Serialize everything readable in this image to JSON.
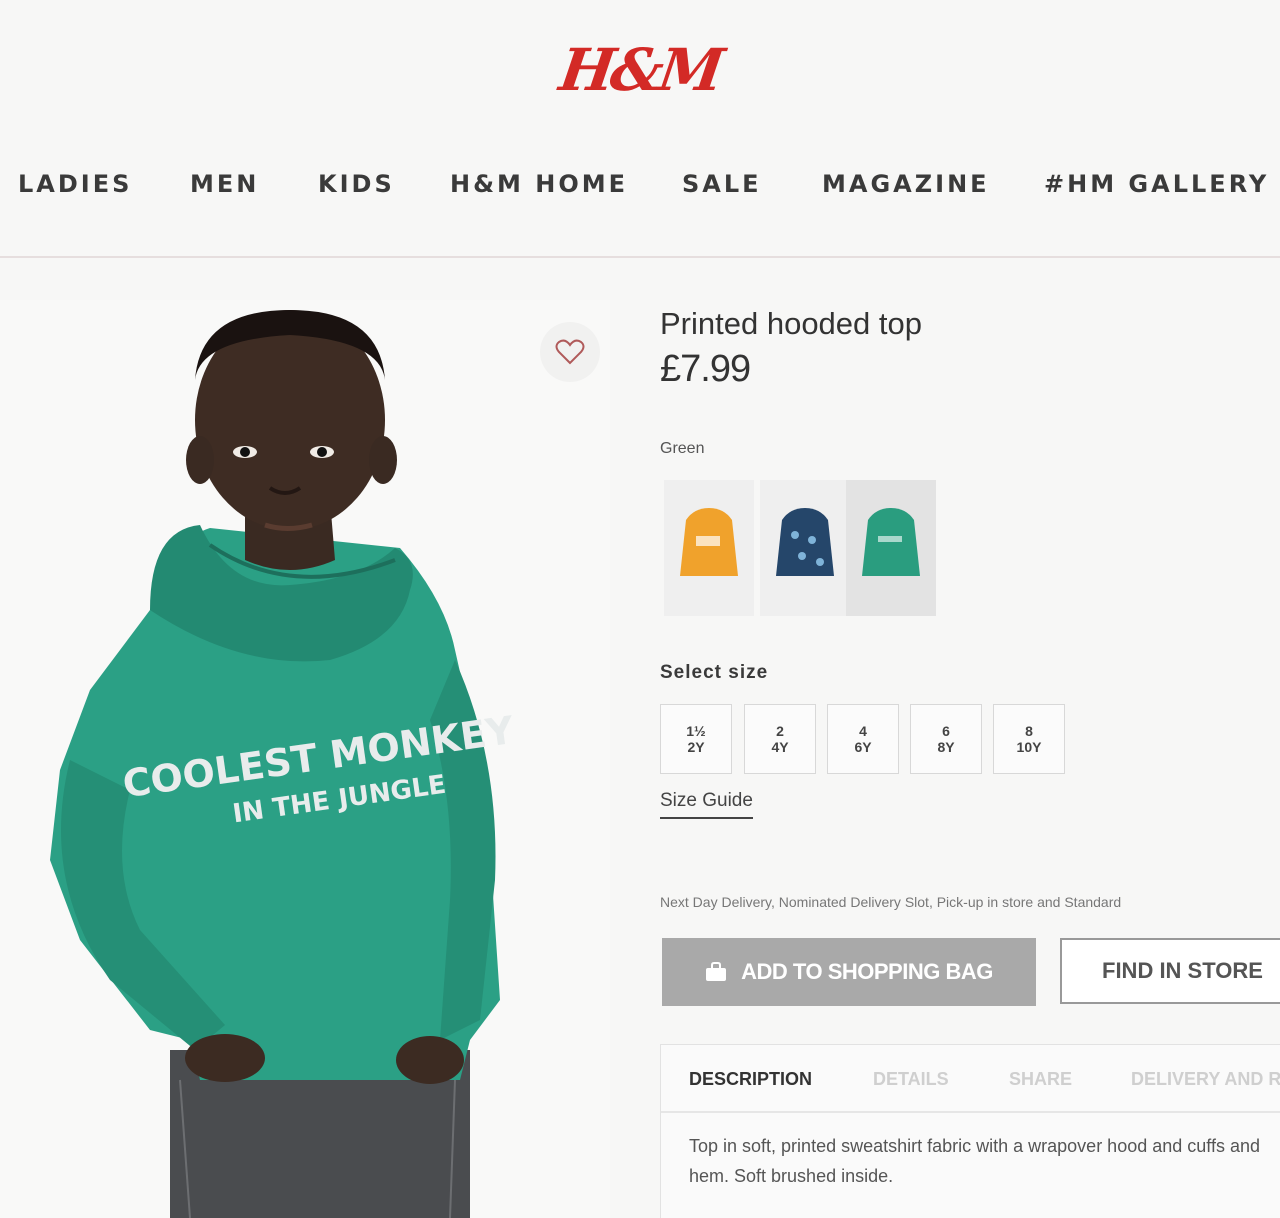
{
  "brand": {
    "logo_text": "H&M",
    "logo_color": "#d32a26"
  },
  "nav": {
    "items": [
      "LADIES",
      "MEN",
      "KIDS",
      "H&M HOME",
      "SALE",
      "MAGAZINE",
      "#HM GALLERY"
    ]
  },
  "product": {
    "title": "Printed hooded top",
    "price": "£7.99",
    "selected_color": "Green",
    "hoodie_print_line1": "COOLEST MONKEY",
    "hoodie_print_line2": "IN THE JUNGLE",
    "swatches": [
      {
        "color": "#f0a22c",
        "name": "orange"
      },
      {
        "color": "#25466a",
        "name": "navy-print"
      },
      {
        "color": "#2a9d7f",
        "name": "green",
        "selected": true
      }
    ]
  },
  "sizes": {
    "label": "Select size",
    "options": [
      {
        "top": "1½",
        "bottom": "2Y"
      },
      {
        "top": "2",
        "bottom": "4Y"
      },
      {
        "top": "4",
        "bottom": "6Y"
      },
      {
        "top": "6",
        "bottom": "8Y"
      },
      {
        "top": "8",
        "bottom": "10Y"
      }
    ],
    "guide_label": "Size Guide"
  },
  "delivery_text": "Next Day Delivery, Nominated Delivery Slot, Pick-up in store and Standard",
  "buttons": {
    "add_to_bag": "ADD TO SHOPPING BAG",
    "find_in_store": "FIND IN STORE"
  },
  "tabs": {
    "items": [
      "DESCRIPTION",
      "DETAILS",
      "SHARE",
      "DELIVERY AND R"
    ],
    "description": "Top in soft, printed sweatshirt fabric with a wrapover hood and cuffs and hem. Soft brushed inside."
  },
  "icons": {
    "favorite": "heart-outline-icon",
    "bag": "shopping-bag-icon"
  }
}
